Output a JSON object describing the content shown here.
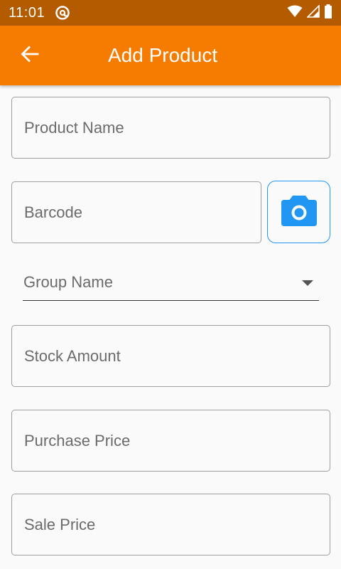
{
  "status_bar": {
    "time": "11:01",
    "app_icon": "at-sign-icon",
    "icons": [
      "wifi-icon",
      "signal-icon",
      "battery-icon"
    ]
  },
  "app_bar": {
    "title": "Add Product",
    "back_icon": "arrow-back-icon",
    "color": "#f57c00"
  },
  "form": {
    "product_name": {
      "label": "Product Name"
    },
    "barcode": {
      "label": "Barcode"
    },
    "scan_button": {
      "icon": "camera-icon",
      "color": "#2196f3"
    },
    "group_name": {
      "label": "Group Name",
      "icon": "dropdown-arrow-icon"
    },
    "stock_amount": {
      "label": "Stock Amount"
    },
    "purchase_price": {
      "label": "Purchase Price"
    },
    "sale_price": {
      "label": "Sale Price"
    }
  }
}
